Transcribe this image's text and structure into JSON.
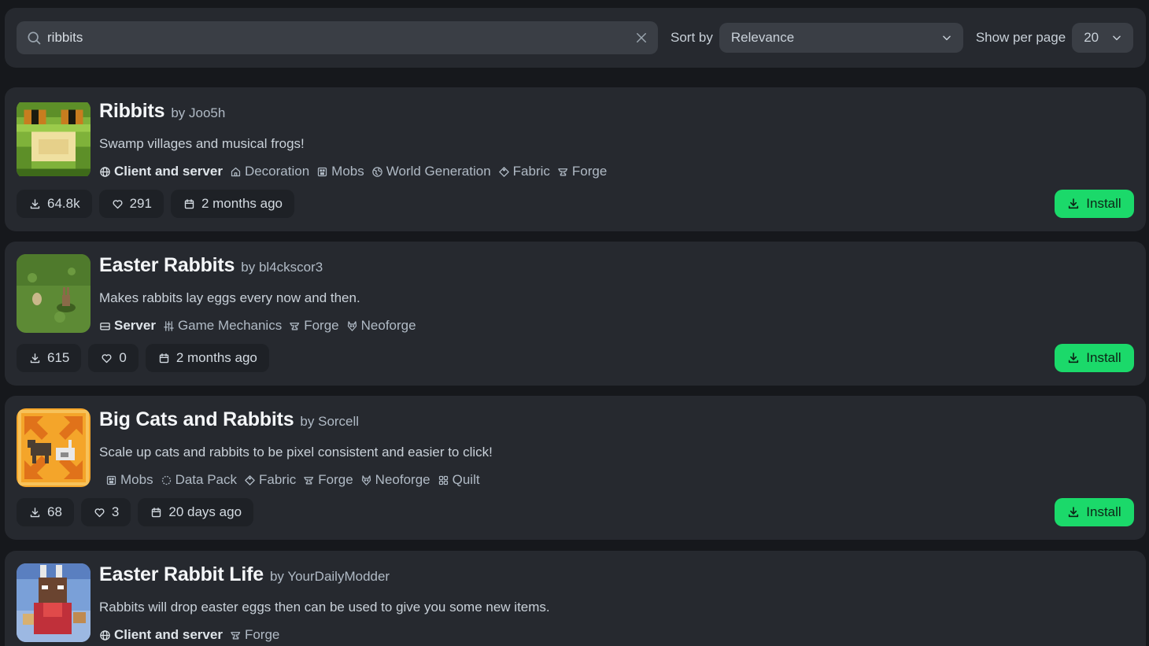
{
  "search": {
    "value": "ribbits",
    "placeholder": "Search mods..."
  },
  "sort": {
    "label": "Sort by",
    "selected": "Relevance"
  },
  "per_page": {
    "label": "Show per page",
    "selected": "20"
  },
  "install_label": "Install",
  "accent_color": "#1bd96a",
  "results": [
    {
      "title": "Ribbits",
      "author": "by Joo5h",
      "description": "Swamp villages and musical frogs!",
      "tags": [
        {
          "icon": "globe-icon",
          "label": "Client and server",
          "env": true
        },
        {
          "icon": "house-icon",
          "label": "Decoration"
        },
        {
          "icon": "mob-icon",
          "label": "Mobs"
        },
        {
          "icon": "globe-outline-icon",
          "label": "World Generation"
        },
        {
          "icon": "tag-icon",
          "label": "Fabric"
        },
        {
          "icon": "anvil-icon",
          "label": "Forge"
        }
      ],
      "downloads": "64.8k",
      "follows": "291",
      "updated": "2 months ago"
    },
    {
      "title": "Easter Rabbits",
      "author": "by bl4ckscor3",
      "description": "Makes rabbits lay eggs every now and then.",
      "tags": [
        {
          "icon": "server-icon",
          "label": "Server",
          "env": true
        },
        {
          "icon": "sliders-icon",
          "label": "Game Mechanics"
        },
        {
          "icon": "anvil-icon",
          "label": "Forge"
        },
        {
          "icon": "fox-icon",
          "label": "Neoforge"
        }
      ],
      "downloads": "615",
      "follows": "0",
      "updated": "2 months ago"
    },
    {
      "title": "Big Cats and Rabbits",
      "author": "by Sorcell",
      "description": "Scale up cats and rabbits to be pixel consistent and easier to click!",
      "tags": [
        {
          "icon": "mob-icon",
          "label": "Mobs"
        },
        {
          "icon": "datapack-icon",
          "label": "Data Pack"
        },
        {
          "icon": "tag-icon",
          "label": "Fabric"
        },
        {
          "icon": "anvil-icon",
          "label": "Forge"
        },
        {
          "icon": "fox-icon",
          "label": "Neoforge"
        },
        {
          "icon": "quilt-icon",
          "label": "Quilt"
        }
      ],
      "downloads": "68",
      "follows": "3",
      "updated": "20 days ago"
    },
    {
      "title": "Easter Rabbit Life",
      "author": "by YourDailyModder",
      "description": "Rabbits will drop easter eggs then can be used to give you some new items.",
      "tags": [
        {
          "icon": "globe-icon",
          "label": "Client and server",
          "env": true
        },
        {
          "icon": "anvil-icon",
          "label": "Forge"
        }
      ],
      "downloads": "",
      "follows": "",
      "updated": ""
    }
  ]
}
